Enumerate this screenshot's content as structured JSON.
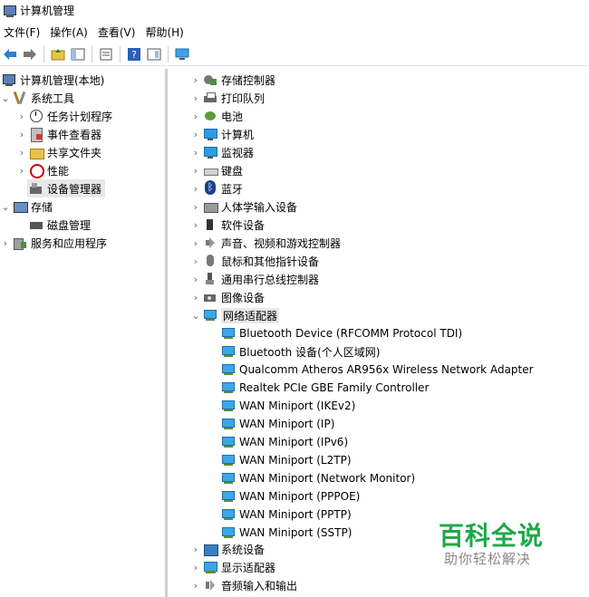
{
  "window": {
    "title": "计算机管理"
  },
  "menu": [
    "文件(F)",
    "操作(A)",
    "查看(V)",
    "帮助(H)"
  ],
  "toolbar": {
    "icons": [
      "back-arrow-icon",
      "forward-arrow-icon",
      "up-folder-icon",
      "show-tree-icon",
      "properties-icon",
      "help-icon",
      "view-icon",
      "monitor-icon"
    ]
  },
  "left_tree": [
    {
      "label": "计算机管理(本地)",
      "icon": "computer-management-icon"
    },
    {
      "label": "系统工具",
      "icon": "system-tools-icon"
    },
    {
      "label": "任务计划程序",
      "icon": "clock-icon"
    },
    {
      "label": "事件查看器",
      "icon": "event-viewer-icon"
    },
    {
      "label": "共享文件夹",
      "icon": "shared-folder-icon"
    },
    {
      "label": "性能",
      "icon": "performance-icon"
    },
    {
      "label": "设备管理器",
      "icon": "device-manager-icon"
    },
    {
      "label": "存储",
      "icon": "storage-icon"
    },
    {
      "label": "磁盘管理",
      "icon": "disk-icon"
    },
    {
      "label": "服务和应用程序",
      "icon": "services-icon"
    }
  ],
  "right_tree": [
    {
      "label": "存储控制器"
    },
    {
      "label": "打印队列"
    },
    {
      "label": "电池"
    },
    {
      "label": "计算机"
    },
    {
      "label": "监视器"
    },
    {
      "label": "键盘"
    },
    {
      "label": "蓝牙"
    },
    {
      "label": "人体学输入设备"
    },
    {
      "label": "软件设备"
    },
    {
      "label": "声音、视频和游戏控制器"
    },
    {
      "label": "鼠标和其他指针设备"
    },
    {
      "label": "通用串行总线控制器"
    },
    {
      "label": "图像设备"
    },
    {
      "label": "网络适配器"
    },
    {
      "label": "Bluetooth Device (RFCOMM Protocol TDI)"
    },
    {
      "label": "Bluetooth 设备(个人区域网)"
    },
    {
      "label": "Qualcomm Atheros AR956x Wireless Network Adapter"
    },
    {
      "label": "Realtek PCIe GBE Family Controller"
    },
    {
      "label": "WAN Miniport (IKEv2)"
    },
    {
      "label": "WAN Miniport (IP)"
    },
    {
      "label": "WAN Miniport (IPv6)"
    },
    {
      "label": "WAN Miniport (L2TP)"
    },
    {
      "label": "WAN Miniport (Network Monitor)"
    },
    {
      "label": "WAN Miniport (PPPOE)"
    },
    {
      "label": "WAN Miniport (PPTP)"
    },
    {
      "label": "WAN Miniport (SSTP)"
    },
    {
      "label": "系统设备"
    },
    {
      "label": "显示适配器"
    },
    {
      "label": "音频输入和输出"
    }
  ],
  "watermark": {
    "title": "百科全说",
    "subtitle": "助你轻松解决"
  }
}
